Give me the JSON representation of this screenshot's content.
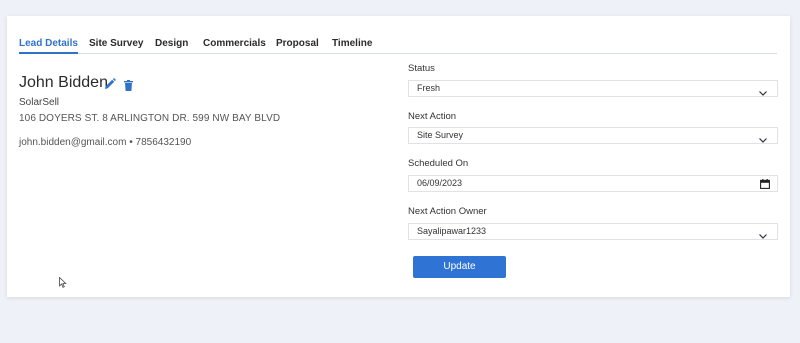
{
  "tabs": [
    {
      "label": "Lead Details",
      "active": true
    },
    {
      "label": "Site Survey",
      "active": false
    },
    {
      "label": "Design",
      "active": false
    },
    {
      "label": "Commercials",
      "active": false
    },
    {
      "label": "Proposal",
      "active": false
    },
    {
      "label": "Timeline",
      "active": false
    }
  ],
  "lead": {
    "name": "John Bidden",
    "company": "SolarSell",
    "address": "106 DOYERS ST. 8 ARLINGTON DR. 599 NW BAY BLVD",
    "email": "john.bidden@gmail.com",
    "separator": "•",
    "phone": "7856432190"
  },
  "icons": {
    "edit": "pencil-icon",
    "delete": "trash-icon",
    "dropdown": "chevron-down-icon",
    "date": "calendar-icon",
    "pointer": "mouse-pointer-icon"
  },
  "form": {
    "status": {
      "label": "Status",
      "value": "Fresh"
    },
    "next_action": {
      "label": "Next Action",
      "value": "Site Survey"
    },
    "scheduled_on": {
      "label": "Scheduled On",
      "value": "06/09/2023"
    },
    "next_action_owner": {
      "label": "Next Action Owner",
      "value": "Sayalipawar1233"
    },
    "update_label": "Update"
  },
  "colors": {
    "accent": "#2f73c9",
    "button": "#2f73d4",
    "background": "#eef1f7"
  }
}
